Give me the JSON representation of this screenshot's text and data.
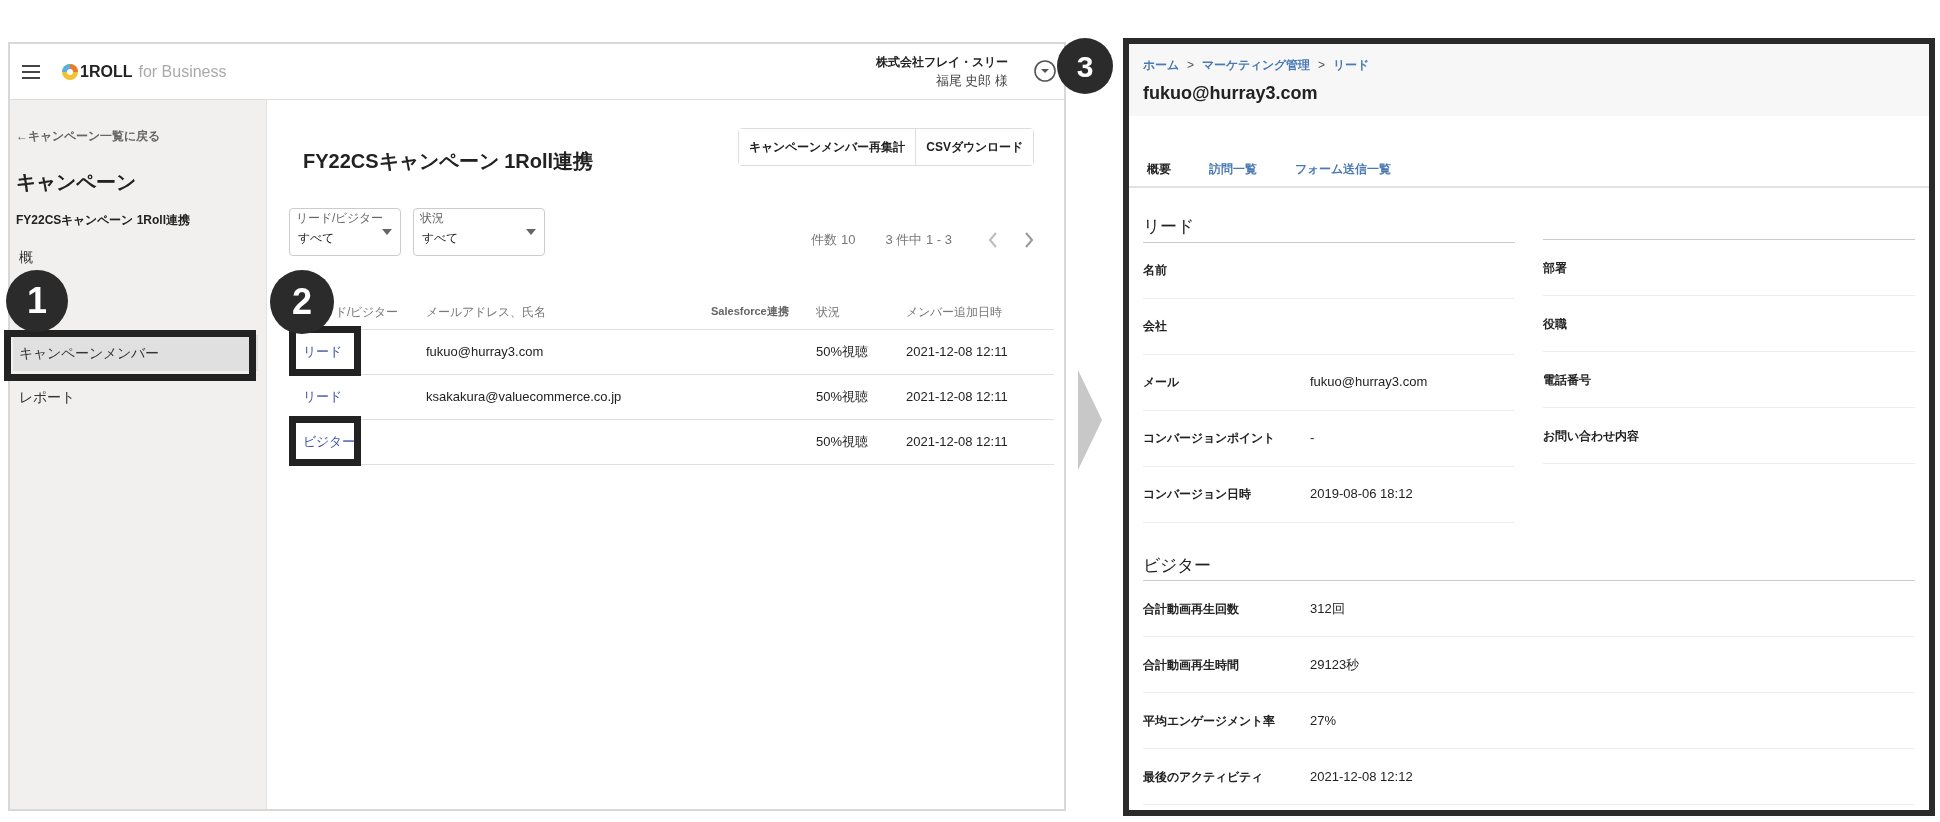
{
  "app_window": {
    "logo": {
      "brand": "1ROLL",
      "suffix": "for Business"
    },
    "account": {
      "company": "株式会社フレイ・スリー",
      "user": "福尾 史郎 様"
    },
    "sidebar": {
      "back_link": "←キャンペーン一覧に戻る",
      "heading": "キャンペーン",
      "campaign": "FY22CSキャンペーン 1Roll連携",
      "items": [
        {
          "label": "概",
          "selected": false
        },
        {
          "label": "キャンペーンメンバー",
          "selected": true
        },
        {
          "label": "レポート",
          "selected": false
        }
      ]
    },
    "main": {
      "title": "FY22CSキャンペーン 1Roll連携",
      "buttons": [
        "キャンペーンメンバー再集計",
        "CSVダウンロード"
      ],
      "filters": [
        {
          "label": "リード/ビジター",
          "value": "すべて"
        },
        {
          "label": "状況",
          "value": "すべて"
        }
      ],
      "page_size": "件数 10",
      "range": "3 件中 1 - 3",
      "table": {
        "columns": [
          "ド/ビジター",
          "メールアドレス、氏名",
          "Salesforce連携",
          "状況",
          "メンバー追加日時"
        ],
        "rows": [
          {
            "type": "リード",
            "email": "fukuo@hurray3.com",
            "status": "50%視聴",
            "added": "2021-12-08 12:11",
            "highlighted": true
          },
          {
            "type": "リード",
            "email": "ksakakura@valuecommerce.co.jp",
            "status": "50%視聴",
            "added": "2021-12-08 12:11",
            "highlighted": false
          },
          {
            "type": "ビジター",
            "status": "50%視聴",
            "added": "2021-12-08 12:11",
            "highlighted": true
          }
        ]
      }
    }
  },
  "annotations": [
    "1",
    "2",
    "3"
  ],
  "detail_panel": {
    "breadcrumb": [
      {
        "kind": "link",
        "text": "ホーム"
      },
      {
        "kind": "separator",
        "text": ">"
      },
      {
        "kind": "link",
        "text": "マーケティング管理"
      },
      {
        "kind": "separator",
        "text": ">"
      },
      {
        "kind": "link",
        "text": "リード"
      }
    ],
    "title": "fukuo@hurray3.com",
    "tabs": [
      {
        "label": "概要",
        "selected": true
      },
      {
        "label": "訪問一覧",
        "selected": false
      },
      {
        "label": "フォーム送信一覧",
        "selected": false
      }
    ],
    "lead_section": {
      "title": "リード",
      "left": [
        {
          "label": "名前"
        },
        {
          "label": "会社"
        },
        {
          "label": "メール",
          "value": "fukuo@hurray3.com"
        },
        {
          "label": "コンバージョンポイント",
          "value": "-"
        },
        {
          "label": "コンバージョン日時",
          "value": "2019-08-06 18:12"
        }
      ],
      "right": [
        {
          "label": "部署"
        },
        {
          "label": "役職"
        },
        {
          "label": "電話番号"
        },
        {
          "label": "お問い合わせ内容"
        }
      ]
    },
    "visitor_section": {
      "title": "ビジター",
      "fields": [
        {
          "label": "合計動画再生回数",
          "value": "312回"
        },
        {
          "label": "合計動画再生時間",
          "value": "29123秒"
        },
        {
          "label": "平均エンゲージメント率",
          "value": "27%"
        },
        {
          "label": "最後のアクティビティ",
          "value": "2021-12-08 12:12"
        }
      ]
    }
  }
}
